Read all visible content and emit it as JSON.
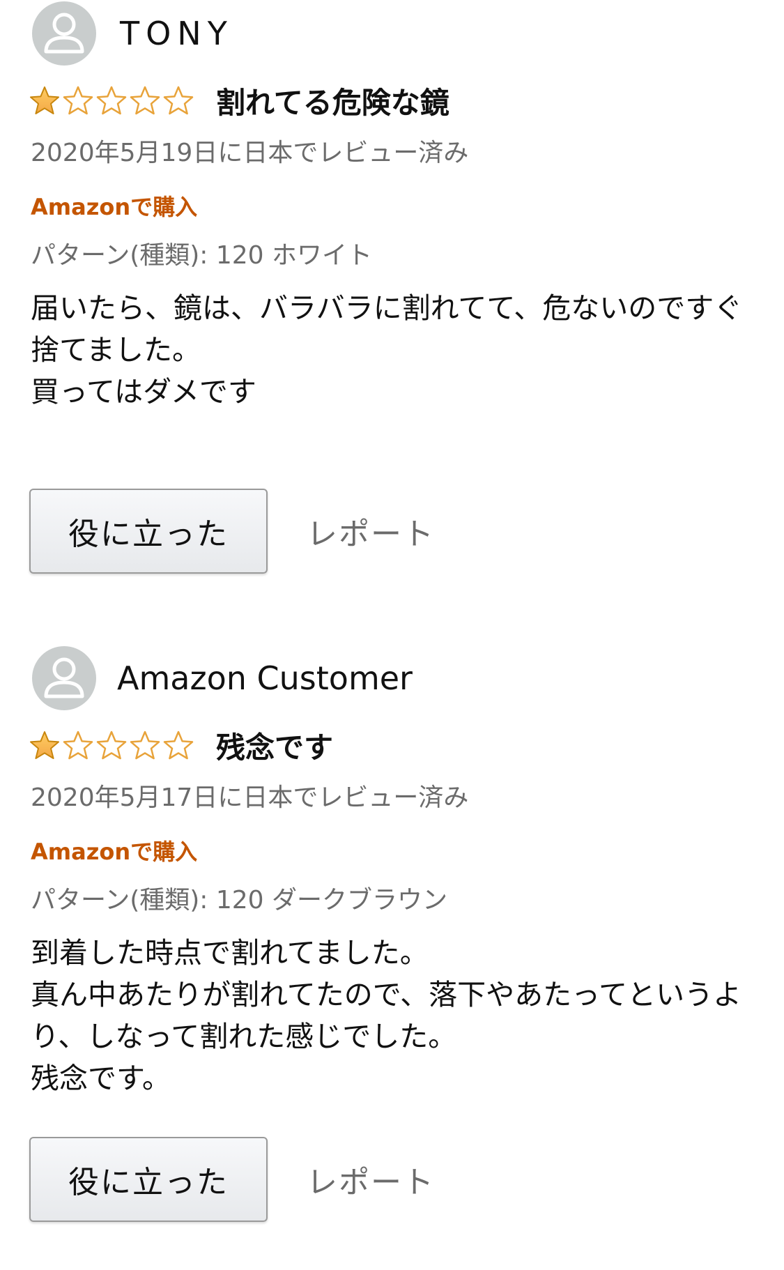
{
  "colors": {
    "star_filled": "#f3a847",
    "star_outline": "#e8a33a",
    "purchase_badge": "#c45500",
    "meta_text": "#6b6b6b",
    "avatar_bg": "#c9cdcd"
  },
  "reviews": [
    {
      "username": "TONY",
      "rating": 1,
      "rating_max": 5,
      "title": "割れてる危険な鏡",
      "date": "2020年5月19日に日本でレビュー済み",
      "purchase_badge": "Amazonで購入",
      "variant": "パターン(種類): 120 ホワイト",
      "body": [
        "届いたら、鏡は、バラバラに割れてて、危ないのですぐ捨てました。",
        "",
        "買ってはダメです"
      ],
      "helpful_label": "役に立った",
      "report_label": "レポート"
    },
    {
      "username": "Amazon Customer",
      "rating": 1,
      "rating_max": 5,
      "title": "残念です",
      "date": "2020年5月17日に日本でレビュー済み",
      "purchase_badge": "Amazonで購入",
      "variant": "パターン(種類): 120 ダークブラウン",
      "body": [
        "到着した時点で割れてました。",
        "真ん中あたりが割れてたので、落下やあたってというより、しなって割れた感じでした。",
        "残念です。"
      ],
      "helpful_label": "役に立った",
      "report_label": "レポート"
    }
  ]
}
